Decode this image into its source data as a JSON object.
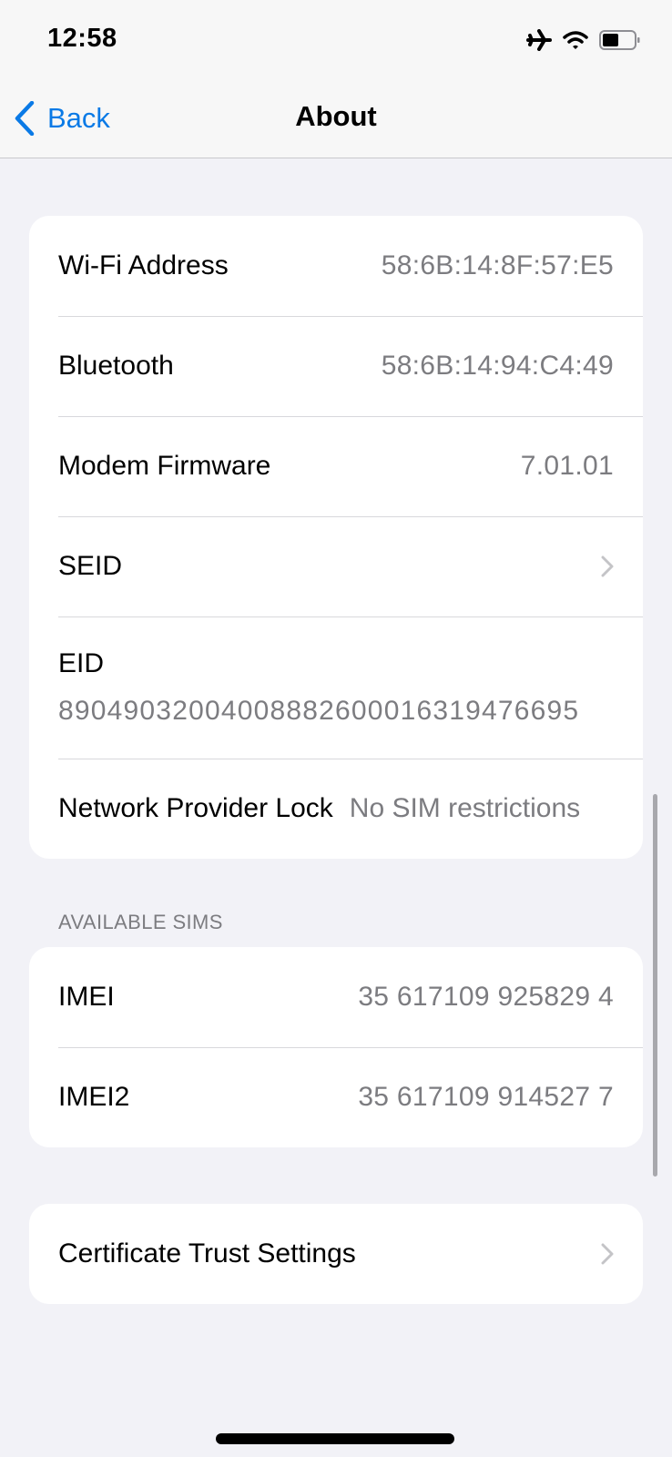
{
  "status_bar": {
    "time": "12:58",
    "icons": [
      "airplane-mode-icon",
      "wifi-icon",
      "battery-icon"
    ],
    "battery_level": 0.45
  },
  "nav": {
    "back_label": "Back",
    "back_icon": "chevron-left-icon",
    "title": "About"
  },
  "colors": {
    "accent": "#0a7ae6",
    "background": "#f2f2f7",
    "secondary_text": "#7c7c80"
  },
  "groups": {
    "info": {
      "rows": [
        {
          "label": "Wi-Fi Address",
          "value": "58:6B:14:8F:57:E5"
        },
        {
          "label": "Bluetooth",
          "value": "58:6B:14:94:C4:49"
        },
        {
          "label": "Modem Firmware",
          "value": "7.01.01"
        },
        {
          "label": "SEID",
          "icon": "chevron-right-icon"
        },
        {
          "label": "EID",
          "value": "89049032004008882600016319476695"
        },
        {
          "label": "Network Provider Lock",
          "value": "No SIM restrictions"
        }
      ]
    },
    "sims": {
      "header": "AVAILABLE SIMS",
      "rows": [
        {
          "label": "IMEI",
          "value": "35 617109 925829 4"
        },
        {
          "label": "IMEI2",
          "value": "35 617109 914527 7"
        }
      ]
    },
    "certs": {
      "rows": [
        {
          "label": "Certificate Trust Settings",
          "icon": "chevron-right-icon"
        }
      ]
    }
  }
}
